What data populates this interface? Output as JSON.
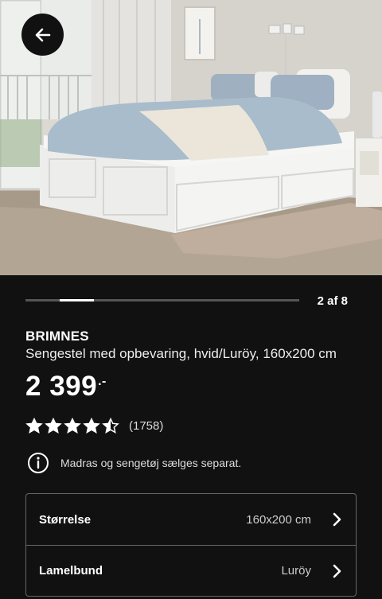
{
  "gallery": {
    "counter": "2 af 8",
    "current": 2,
    "total": 8
  },
  "icons": {
    "back": "arrow-left-icon",
    "info": "info-icon",
    "chevron": "chevron-right-icon",
    "star": "star-icon"
  },
  "product": {
    "name": "BRIMNES",
    "description": "Sengestel med opbevaring, hvid/Luröy, 160x200 cm",
    "price": "2 399",
    "price_suffix": ".-",
    "rating": {
      "value": 4.5,
      "max": 5,
      "count": "(1758)"
    },
    "notice": "Madras og sengetøj sælges separat."
  },
  "options": [
    {
      "label": "Størrelse",
      "value": "160x200 cm"
    },
    {
      "label": "Lamelbund",
      "value": "Luröy"
    }
  ],
  "colors": {
    "background": "#111111",
    "text": "#ffffff",
    "border": "#666666"
  }
}
